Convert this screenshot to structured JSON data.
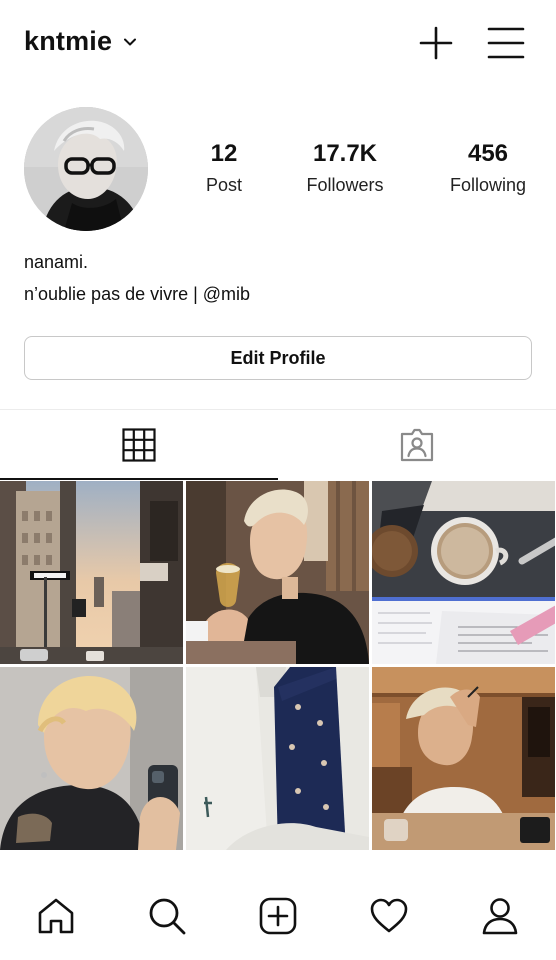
{
  "header": {
    "username": "kntmie",
    "chevron_icon": "chevron-down-icon",
    "new_post_icon": "plus-icon",
    "menu_icon": "hamburger-menu-icon"
  },
  "profile": {
    "avatar_icon": "profile-avatar",
    "stats": [
      {
        "value": "12",
        "label": "Post"
      },
      {
        "value": "17.7K",
        "label": "Followers"
      },
      {
        "value": "456",
        "label": "Following"
      }
    ],
    "name": "nanami.",
    "bio": "n’oublie pas de vivre | @mib"
  },
  "actions": {
    "edit_profile_label": "Edit Profile"
  },
  "tabs": [
    {
      "icon": "grid-icon",
      "selected": true
    },
    {
      "icon": "tagged-person-icon",
      "selected": false
    }
  ],
  "posts": [
    {
      "subject": "city street at dusk"
    },
    {
      "subject": "blonde man drinking"
    },
    {
      "subject": "coffee cup on desk"
    },
    {
      "subject": "mirror selfie"
    },
    {
      "subject": "navy patterned tie"
    },
    {
      "subject": "man at restaurant table"
    }
  ],
  "bottom_nav": [
    {
      "icon": "home-icon"
    },
    {
      "icon": "search-icon"
    },
    {
      "icon": "add-post-icon"
    },
    {
      "icon": "heart-icon"
    },
    {
      "icon": "profile-icon"
    }
  ]
}
